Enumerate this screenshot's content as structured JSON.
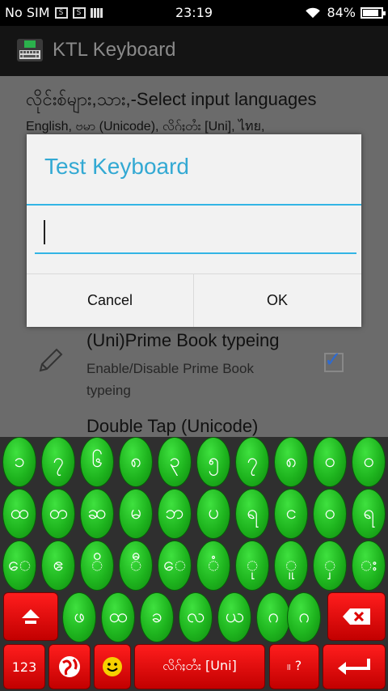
{
  "status_bar": {
    "carrier": "No SIM",
    "time": "23:19",
    "battery": "84%"
  },
  "action_bar": {
    "title": "KTL Keyboard"
  },
  "settings": {
    "input_languages_title": "လိုင်းစ်များ,သား,-Select input languages",
    "input_languages_summary": "English, ဗမာ (Unicode), လိဂ်ႈတႆး [Uni], ไทย,",
    "prime_book_title": "(Uni)Prime Book typeing",
    "prime_book_summary": "Enable/Disable Prime Book typeing",
    "prime_book_checked": true,
    "double_tap_title": "Double Tap (Unicode)"
  },
  "dialog": {
    "title": "Test Keyboard",
    "input_value": "",
    "cancel_label": "Cancel",
    "ok_label": "OK"
  },
  "keyboard": {
    "row1": [
      "၁",
      "၇",
      "၆",
      "၈",
      "၃",
      "၅",
      "၇",
      "၈",
      "၀",
      "ဝ"
    ],
    "row2": [
      "ထ",
      "တ",
      "ဆ",
      "မ",
      "ဘ",
      "ပ",
      "ရ",
      "င",
      "ဝ",
      "ရ"
    ],
    "row3": [
      "ေ",
      "ဧ",
      "ိ",
      "ီ",
      "ေ",
      "ံ",
      "ု",
      "ူ",
      "ှ",
      "း"
    ],
    "row4": [
      "ဖ",
      "ထ",
      "ခ",
      "လ",
      "ယ",
      "ဂ",
      "ဂ"
    ],
    "space_label": "လိဂ်ႈတႆး [Uni]",
    "numbers_label": "123",
    "punct_label": "။ ?",
    "colors": {
      "green_key": "#1eb41e",
      "red_key": "#e00000",
      "dialog_accent": "#33b5e5"
    }
  }
}
